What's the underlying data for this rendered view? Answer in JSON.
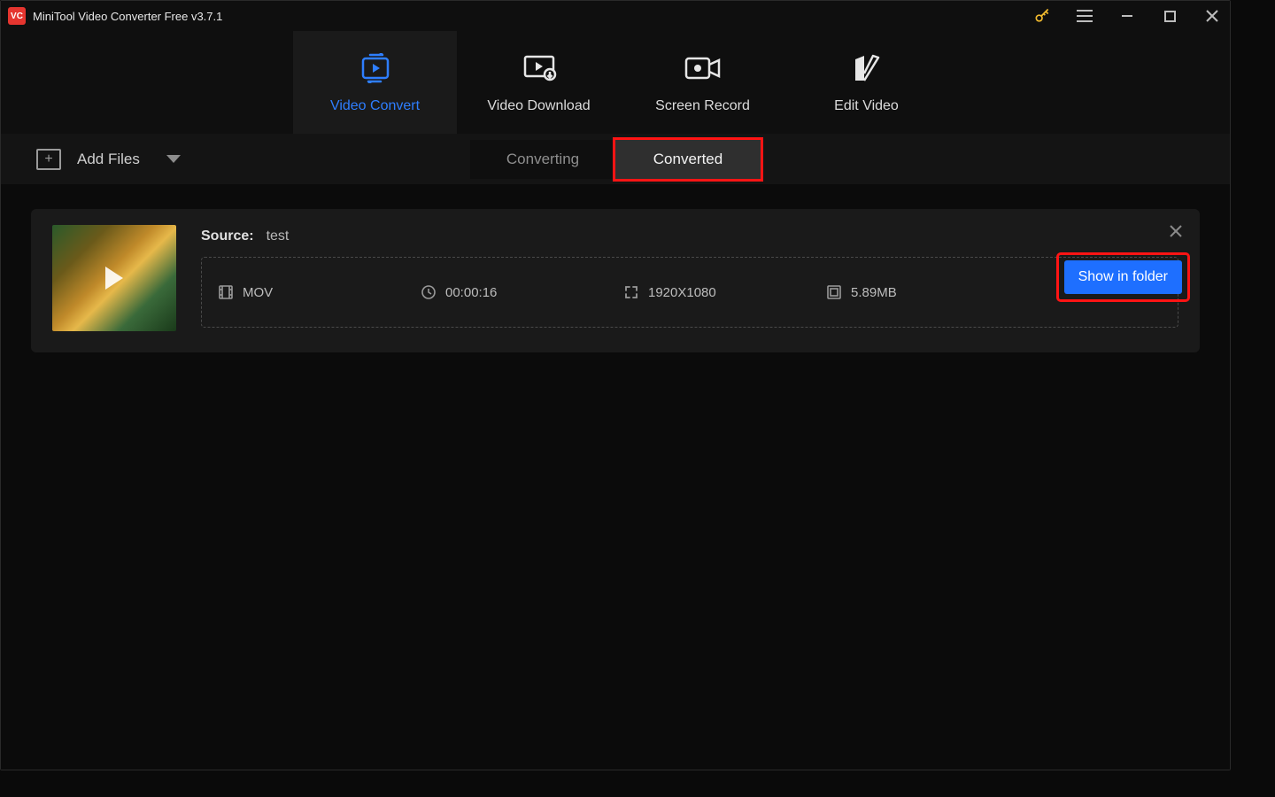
{
  "title": "MiniTool Video Converter Free v3.7.1",
  "nav": {
    "items": [
      {
        "label": "Video Convert"
      },
      {
        "label": "Video Download"
      },
      {
        "label": "Screen Record"
      },
      {
        "label": "Edit Video"
      }
    ]
  },
  "toolbar": {
    "add_files_label": "Add Files"
  },
  "subtabs": {
    "converting": "Converting",
    "converted": "Converted"
  },
  "item": {
    "source_label": "Source:",
    "source_name": "test",
    "format": "MOV",
    "duration": "00:00:16",
    "resolution": "1920X1080",
    "size": "5.89MB",
    "show_in_folder": "Show in folder"
  }
}
